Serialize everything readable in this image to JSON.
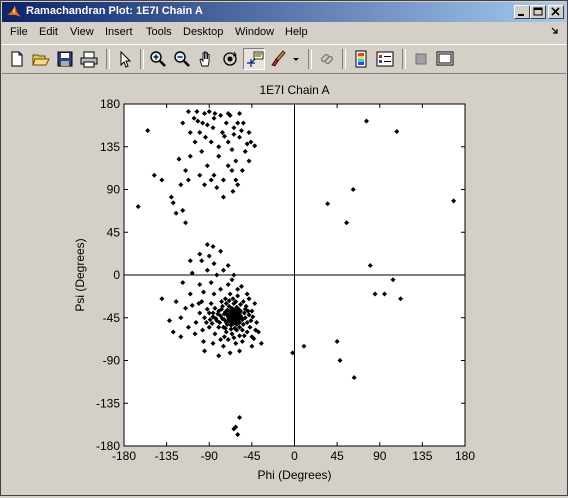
{
  "window": {
    "title": "Ramachandran Plot: 1E7I Chain A"
  },
  "menu": {
    "items": [
      "File",
      "Edit",
      "View",
      "Insert",
      "Tools",
      "Desktop",
      "Window",
      "Help"
    ],
    "overflow_icon": "dock-arrow-icon"
  },
  "toolbar": {
    "icons": [
      "new-figure-icon",
      "open-file-icon",
      "save-icon",
      "print-icon",
      "edit-plot-arrow-icon",
      "zoom-in-icon",
      "zoom-out-icon",
      "pan-hand-icon",
      "rotate-3d-icon",
      "data-cursor-icon",
      "brush-icon",
      "link-icon",
      "colorbar-icon",
      "legend-icon",
      "hide-plot-tools-icon",
      "show-plot-tools-icon"
    ]
  },
  "chart_data": {
    "type": "scatter",
    "title": "1E7I Chain A",
    "xlabel": "Phi (Degrees)",
    "ylabel": "Psi (Degrees)",
    "xlim": [
      -180,
      180
    ],
    "ylim": [
      -180,
      180
    ],
    "xticks": [
      -180,
      -135,
      -90,
      -45,
      0,
      45,
      90,
      135,
      180
    ],
    "yticks": [
      -180,
      -135,
      -90,
      -45,
      0,
      45,
      90,
      135,
      180
    ],
    "xtick_labels": [
      "-180",
      "-135",
      "-90",
      "-45",
      "0",
      "45",
      "90",
      "135",
      "180"
    ],
    "ytick_labels": [
      "-180",
      "-135",
      "-90",
      "-45",
      "0",
      "45",
      "90",
      "135",
      "180"
    ],
    "grid": false,
    "zero_lines": true,
    "marker": "diamond",
    "marker_color": "#000000",
    "series": [
      {
        "points": [
          [
            -63,
            -42
          ],
          [
            -65,
            -40
          ],
          [
            -60,
            -45
          ],
          [
            -68,
            -38
          ],
          [
            -62,
            -48
          ],
          [
            -58,
            -40
          ],
          [
            -70,
            -44
          ],
          [
            -66,
            -35
          ],
          [
            -55,
            -47
          ],
          [
            -72,
            -50
          ],
          [
            -64,
            -30
          ],
          [
            -61,
            -52
          ],
          [
            -67,
            -46
          ],
          [
            -59,
            -36
          ],
          [
            -74,
            -41
          ],
          [
            -63,
            -56
          ],
          [
            -57,
            -43
          ],
          [
            -69,
            -33
          ],
          [
            -65,
            -50
          ],
          [
            -60,
            -38
          ],
          [
            -76,
            -46
          ],
          [
            -53,
            -40
          ],
          [
            -71,
            -37
          ],
          [
            -62,
            -44
          ],
          [
            -66,
            -42
          ],
          [
            -58,
            -50
          ],
          [
            -64,
            -47
          ],
          [
            -68,
            -43
          ],
          [
            -60,
            -41
          ],
          [
            -73,
            -39
          ],
          [
            -56,
            -45
          ],
          [
            -67,
            -53
          ],
          [
            -61,
            -34
          ],
          [
            -70,
            -48
          ],
          [
            -63,
            -37
          ],
          [
            -59,
            -47
          ],
          [
            -65,
            -44
          ],
          [
            -62,
            -39
          ],
          [
            -69,
            -41
          ],
          [
            -64,
            -51
          ],
          [
            -78,
            -43
          ],
          [
            -80,
            -38
          ],
          [
            -82,
            -48
          ],
          [
            -84,
            -35
          ],
          [
            -75,
            -55
          ],
          [
            -50,
            -50
          ],
          [
            -48,
            -42
          ],
          [
            -52,
            -36
          ],
          [
            -55,
            -58
          ],
          [
            -86,
            -44
          ],
          [
            -88,
            -30
          ],
          [
            -90,
            -40
          ],
          [
            -77,
            -28
          ],
          [
            -73,
            -25
          ],
          [
            -60,
            -22
          ],
          [
            -68,
            -20
          ],
          [
            -54,
            -28
          ],
          [
            -47,
            -55
          ],
          [
            -45,
            -38
          ],
          [
            -80,
            -55
          ],
          [
            -92,
            -36
          ],
          [
            -95,
            -45
          ],
          [
            -98,
            -28
          ],
          [
            -85,
            -20
          ],
          [
            -78,
            -15
          ],
          [
            -70,
            -10
          ],
          [
            -66,
            -5
          ],
          [
            -60,
            -15
          ],
          [
            -72,
            -60
          ],
          [
            -66,
            -62
          ],
          [
            -58,
            -64
          ],
          [
            -50,
            -60
          ],
          [
            -84,
            -62
          ],
          [
            -90,
            -55
          ],
          [
            -100,
            -40
          ],
          [
            -104,
            -50
          ],
          [
            -108,
            -32
          ],
          [
            -96,
            -18
          ],
          [
            -88,
            -8
          ],
          [
            -82,
            0
          ],
          [
            -75,
            5
          ],
          [
            -70,
            10
          ],
          [
            -85,
            12
          ],
          [
            -92,
            5
          ],
          [
            -100,
            -10
          ],
          [
            -110,
            -20
          ],
          [
            -115,
            -35
          ],
          [
            -120,
            -45
          ],
          [
            -112,
            -55
          ],
          [
            -105,
            -62
          ],
          [
            -96,
            -70
          ],
          [
            -86,
            -72
          ],
          [
            -75,
            -75
          ],
          [
            -62,
            -72
          ],
          [
            -55,
            -70
          ],
          [
            -45,
            -65
          ],
          [
            -40,
            -50
          ],
          [
            -42,
            -30
          ],
          [
            -48,
            -25
          ],
          [
            -38,
            -60
          ],
          [
            -118,
            -8
          ],
          [
            -125,
            -28
          ],
          [
            -108,
            2
          ],
          [
            -98,
            15
          ],
          [
            -90,
            20
          ],
          [
            -86,
            30
          ],
          [
            -92,
            32
          ],
          [
            -100,
            22
          ],
          [
            -110,
            15
          ],
          [
            -58,
            -80
          ],
          [
            -68,
            -82
          ],
          [
            -80,
            -85
          ],
          [
            -45,
            -75
          ],
          [
            -35,
            -72
          ],
          [
            -50,
            -20
          ],
          [
            -56,
            -12
          ],
          [
            -64,
            0
          ],
          [
            -78,
            25
          ],
          [
            -95,
            -80
          ],
          [
            -132,
            -48
          ],
          [
            -140,
            -25
          ],
          [
            -128,
            -60
          ],
          [
            -120,
            -65
          ],
          [
            -76,
            -33
          ],
          [
            -74,
            -47
          ],
          [
            -71,
            -52
          ],
          [
            -57,
            -31
          ],
          [
            -54,
            -52
          ],
          [
            -52,
            -45
          ],
          [
            -61,
            -58
          ],
          [
            -67,
            -57
          ],
          [
            -79,
            -50
          ],
          [
            -81,
            -41
          ],
          [
            -77,
            -36
          ],
          [
            -83,
            -46
          ],
          [
            -87,
            -51
          ],
          [
            -89,
            -47
          ],
          [
            -72,
            -30
          ],
          [
            -62,
            -28
          ],
          [
            -65,
            -25
          ],
          [
            -69,
            -27
          ],
          [
            -58,
            -55
          ],
          [
            -46,
            -48
          ],
          [
            -44,
            -44
          ],
          [
            -49,
            -38
          ],
          [
            -51,
            -33
          ],
          [
            -53,
            -64
          ],
          [
            -41,
            -58
          ],
          [
            -43,
            -67
          ],
          [
            -86,
            -40
          ],
          [
            -93,
            -50
          ],
          [
            -97,
            -58
          ],
          [
            -101,
            -30
          ],
          [
            -74,
            -65
          ],
          [
            -78,
            -68
          ],
          [
            -70,
            -68
          ],
          [
            -64,
            -66
          ],
          [
            -73,
            -56
          ],
          [
            -66,
            -48
          ],
          [
            -61,
            -49
          ],
          [
            -63,
            -45
          ],
          [
            -66,
            -39
          ],
          [
            -60,
            -43
          ],
          [
            -68,
            -49
          ],
          [
            -57,
            -38
          ],
          [
            -71,
            -42
          ],
          [
            -64,
            -43
          ],
          [
            -62,
            -50
          ],
          [
            -69,
            -46
          ],
          [
            -59,
            -44
          ],
          [
            -60,
            -168
          ],
          [
            -64,
            -162
          ],
          [
            -58,
            -150
          ],
          [
            -62,
            -160
          ],
          [
            -155,
            152
          ],
          [
            -165,
            72
          ],
          [
            -148,
            105
          ],
          [
            -140,
            100
          ],
          [
            -130,
            82
          ],
          [
            -128,
            76
          ],
          [
            -120,
            95
          ],
          [
            -125,
            65
          ],
          [
            -115,
            110
          ],
          [
            -110,
            125
          ],
          [
            -118,
            160
          ],
          [
            -112,
            172
          ],
          [
            -106,
            165
          ],
          [
            -100,
            150
          ],
          [
            -95,
            170
          ],
          [
            -92,
            158
          ],
          [
            -88,
            140
          ],
          [
            -85,
            165
          ],
          [
            -80,
            125
          ],
          [
            -76,
            150
          ],
          [
            -72,
            160
          ],
          [
            -70,
            140
          ],
          [
            -66,
            132
          ],
          [
            -62,
            120
          ],
          [
            -58,
            145
          ],
          [
            -54,
            160
          ],
          [
            -50,
            138
          ],
          [
            -48,
            150
          ],
          [
            -60,
            95
          ],
          [
            -75,
            100
          ],
          [
            -85,
            105
          ],
          [
            -92,
            115
          ],
          [
            -98,
            130
          ],
          [
            -105,
            140
          ],
          [
            -110,
            150
          ],
          [
            -103,
            172
          ],
          [
            -90,
            172
          ],
          [
            -84,
            170
          ],
          [
            -78,
            168
          ],
          [
            -68,
            168
          ],
          [
            -64,
            155
          ],
          [
            -56,
            152
          ],
          [
            -52,
            130
          ],
          [
            -46,
            140
          ],
          [
            -42,
            136
          ],
          [
            -70,
            115
          ],
          [
            -66,
            110
          ],
          [
            -82,
            92
          ],
          [
            -88,
            100
          ],
          [
            -95,
            95
          ],
          [
            -100,
            105
          ],
          [
            -112,
            100
          ],
          [
            -122,
            122
          ],
          [
            -75,
            82
          ],
          [
            -65,
            88
          ],
          [
            -55,
            110
          ],
          [
            -62,
            100
          ],
          [
            -80,
            135
          ],
          [
            -94,
            145
          ],
          [
            -86,
            155
          ],
          [
            -70,
            170
          ],
          [
            -60,
            160
          ],
          [
            -48,
            120
          ],
          [
            -115,
            55
          ],
          [
            -118,
            68
          ],
          [
            -102,
            162
          ],
          [
            -97,
            160
          ],
          [
            -74,
            146
          ],
          [
            -64,
            148
          ],
          [
            -58,
            170
          ],
          [
            76,
            162
          ],
          [
            108,
            151
          ],
          [
            168,
            78
          ],
          [
            35,
            75
          ],
          [
            62,
            90
          ],
          [
            55,
            55
          ],
          [
            80,
            10
          ],
          [
            48,
            -90
          ],
          [
            104,
            -5
          ],
          [
            95,
            -20
          ],
          [
            85,
            -20
          ],
          [
            112,
            -25
          ],
          [
            -2,
            -82
          ],
          [
            10,
            -75
          ],
          [
            45,
            -70
          ],
          [
            63,
            -108
          ]
        ]
      }
    ]
  }
}
